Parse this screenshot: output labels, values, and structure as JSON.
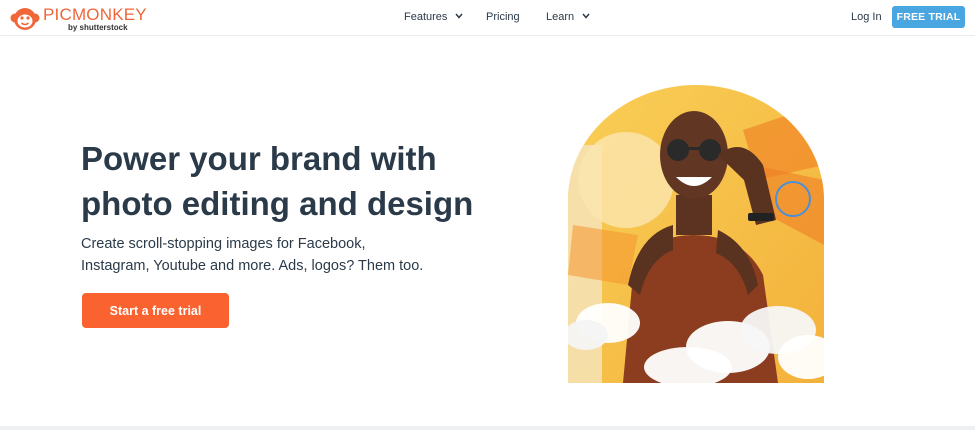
{
  "brand": {
    "name": "PICMONKEY",
    "tagline": "by shutterstock",
    "color": "#f0663a"
  },
  "nav": {
    "items": [
      {
        "label": "Features",
        "has_dropdown": true,
        "icon": "chevron-down-icon"
      },
      {
        "label": "Pricing",
        "has_dropdown": false
      },
      {
        "label": "Learn",
        "has_dropdown": true,
        "icon": "chevron-down-icon"
      }
    ],
    "login_label": "Log In",
    "trial_label": "FREE TRIAL",
    "trial_color": "#4aa6e0"
  },
  "hero": {
    "title_line1": "Power your brand with",
    "title_line2": "photo editing and design",
    "subtitle_line1": "Create scroll-stopping images for Facebook,",
    "subtitle_line2": "Instagram, Youtube and more. Ads, logos? Them too.",
    "cta_label": "Start a free trial",
    "cta_color": "#fa6230",
    "image_icon": "hero-photo-woman-sunglasses"
  }
}
